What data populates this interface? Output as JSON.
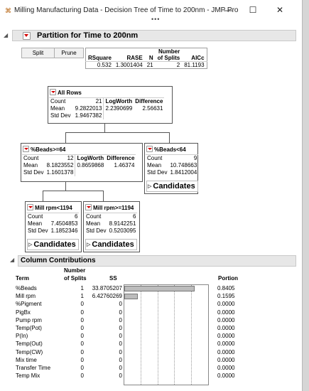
{
  "window": {
    "title": "Milling Manufacturing Data - Decision Tree of Time to 200nm - JMP Pro",
    "app_icon": "jmp-app-icon",
    "controls": {
      "minimize": "—",
      "maximize": "☐",
      "close": "✕"
    },
    "overflow": "•••"
  },
  "partition": {
    "title": "Partition for Time to 200nm",
    "split_label": "Split",
    "prune_label": "Prune",
    "summary": {
      "headers": [
        "RSquare",
        "RASE",
        "N",
        "Number of Splits",
        "AICc"
      ],
      "header_number": "Number",
      "header_of_splits": "of Splits",
      "values": [
        "0.532",
        "1.3001404",
        "21",
        "2",
        "81.1193"
      ]
    }
  },
  "tree": {
    "root": {
      "title": "All Rows",
      "count_label": "Count",
      "count": "21",
      "logworth_label": "LogWorth",
      "difference_label": "Difference",
      "mean_label": "Mean",
      "mean": "9.2822013",
      "logworth": "2.2390699",
      "difference": "2.56631",
      "sd_label": "Std Dev",
      "sd": "1.9467382"
    },
    "left": {
      "title": "%Beads>=64",
      "count_label": "Count",
      "count": "12",
      "logworth_label": "LogWorth",
      "difference_label": "Difference",
      "mean_label": "Mean",
      "mean": "8.1823552",
      "logworth": "0.8659868",
      "difference": "1.46374",
      "sd_label": "Std Dev",
      "sd": "1.1601378"
    },
    "right": {
      "title": "%Beads<64",
      "count_label": "Count",
      "count": "9",
      "mean_label": "Mean",
      "mean": "10.748663",
      "sd_label": "Std Dev",
      "sd": "1.8412004",
      "candidates_label": "Candidates"
    },
    "leaf_left": {
      "title": "Mill rpm<1194",
      "count_label": "Count",
      "count": "6",
      "mean_label": "Mean",
      "mean": "7.4504853",
      "sd_label": "Std Dev",
      "sd": "1.1852346",
      "candidates_label": "Candidates"
    },
    "leaf_right": {
      "title": "Mill rpm>=1194",
      "count_label": "Count",
      "count": "6",
      "mean_label": "Mean",
      "mean": "8.9142251",
      "sd_label": "Std Dev",
      "sd": "0.5203095",
      "candidates_label": "Candidates"
    }
  },
  "column_contributions": {
    "title": "Column Contributions",
    "headers": {
      "term": "Term",
      "splits_top": "Number",
      "splits_bottom": "of Splits",
      "ss": "SS",
      "portion": "Portion"
    },
    "rows": [
      {
        "term": "%Beads",
        "splits": "1",
        "ss": "33.8705207",
        "portion": "0.8405",
        "fraction": 0.8405
      },
      {
        "term": "Mill rpm",
        "splits": "1",
        "ss": "6.42760269",
        "portion": "0.1595",
        "fraction": 0.1595
      },
      {
        "term": "%Pigment",
        "splits": "0",
        "ss": "0",
        "portion": "0.0000",
        "fraction": 0
      },
      {
        "term": "PigBx",
        "splits": "0",
        "ss": "0",
        "portion": "0.0000",
        "fraction": 0
      },
      {
        "term": "Pump rpm",
        "splits": "0",
        "ss": "0",
        "portion": "0.0000",
        "fraction": 0
      },
      {
        "term": "Temp(Pot)",
        "splits": "0",
        "ss": "0",
        "portion": "0.0000",
        "fraction": 0
      },
      {
        "term": "P(In)",
        "splits": "0",
        "ss": "0",
        "portion": "0.0000",
        "fraction": 0
      },
      {
        "term": "Temp(Out)",
        "splits": "0",
        "ss": "0",
        "portion": "0.0000",
        "fraction": 0
      },
      {
        "term": "Temp(CW)",
        "splits": "0",
        "ss": "0",
        "portion": "0.0000",
        "fraction": 0
      },
      {
        "term": "Mix time",
        "splits": "0",
        "ss": "0",
        "portion": "0.0000",
        "fraction": 0
      },
      {
        "term": "Transfer Time",
        "splits": "0",
        "ss": "0",
        "portion": "0.0000",
        "fraction": 0
      },
      {
        "term": "Temp Mix",
        "splits": "0",
        "ss": "0",
        "portion": "0.0000",
        "fraction": 0
      }
    ]
  }
}
